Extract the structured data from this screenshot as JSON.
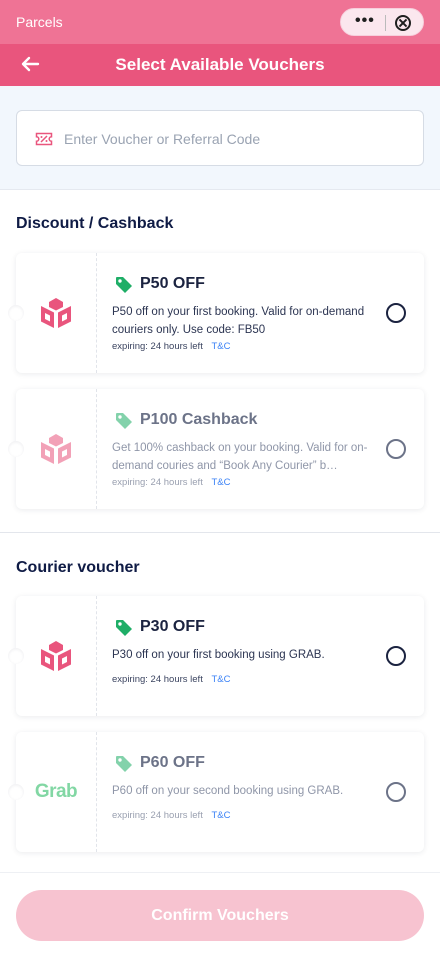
{
  "app": {
    "name": "Parcels"
  },
  "header": {
    "title": "Select Available Vouchers"
  },
  "search": {
    "placeholder": "Enter Voucher or Referral Code",
    "value": ""
  },
  "sections": [
    {
      "title": "Discount / Cashback",
      "vouchers": [
        {
          "title": "P50 OFF",
          "description": "P50 off on your first booking. Valid for on-demand couriers only. Use code: FB50",
          "expiry": "expiring: 24 hours left",
          "tc": "T&C",
          "logo": "box-logo",
          "enabled": true,
          "selected": false
        },
        {
          "title": "P100 Cashback",
          "description": "Get 100% cashback on your booking. Valid for on-demand couries and “Book Any Courier” b…",
          "expiry": "expiring: 24 hours left",
          "tc": "T&C",
          "logo": "box-logo",
          "enabled": false,
          "selected": false
        }
      ]
    },
    {
      "title": "Courier voucher",
      "vouchers": [
        {
          "title": "P30 OFF",
          "description": "P30 off on your first booking using GRAB.",
          "expiry": "expiring: 24 hours left",
          "tc": "T&C",
          "logo": "box-logo",
          "enabled": true,
          "selected": false
        },
        {
          "title": "P60 OFF",
          "description": "P60 off on your second booking using GRAB.",
          "expiry": "expiring: 24 hours left",
          "tc": "T&C",
          "logo": "grab-logo",
          "logo_text": "Grab",
          "enabled": false,
          "selected": false
        }
      ]
    }
  ],
  "footer": {
    "confirm_label": "Confirm Vouchers",
    "confirm_enabled": false
  },
  "colors": {
    "brand": "#e9557d",
    "topbar": "#ef7395",
    "tag_green": "#1fae67",
    "grab_green": "#1db85a",
    "confirm_disabled": "#f7c3d0"
  }
}
